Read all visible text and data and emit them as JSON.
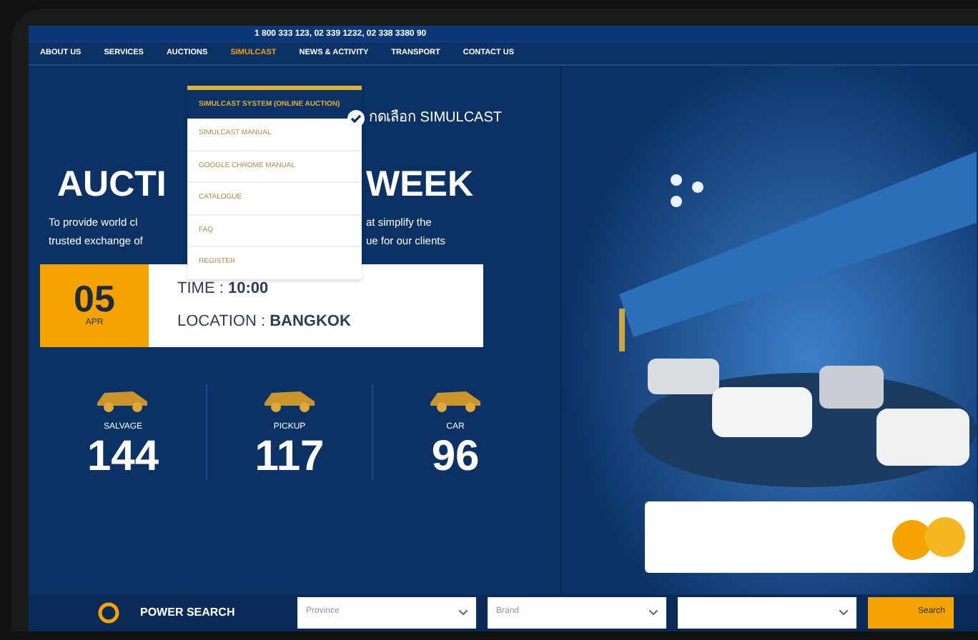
{
  "top_bar": {
    "phone": "1 800 333 123, 02 339 1232, 02 338 3380 90"
  },
  "nav": [
    {
      "label": "ABOUT US",
      "selected": false
    },
    {
      "label": "SERVICES",
      "selected": false
    },
    {
      "label": "AUCTIONS",
      "selected": false
    },
    {
      "label": "SIMULCAST",
      "selected": true
    },
    {
      "label": "NEWS & ACTIVITY",
      "selected": false
    },
    {
      "label": "TRANSPORT",
      "selected": false
    },
    {
      "label": "CONTACT US",
      "selected": false
    }
  ],
  "dropdown": [
    {
      "label": "SIMULCAST SYSTEM (ONLINE AUCTION)",
      "selected": true
    },
    {
      "label": "SIMULCAST MANUAL",
      "selected": false
    },
    {
      "label": "GOOGLE CHROME MANUAL",
      "selected": false
    },
    {
      "label": "CATALOGUE",
      "selected": false
    },
    {
      "label": "FAQ",
      "selected": false
    },
    {
      "label": "REGISTER",
      "selected": false
    }
  ],
  "callout": "กดเลือก SIMULCAST",
  "hero": {
    "title_left": "AUCTI",
    "title_right": "WEEK",
    "text_left": [
      "To provide world cl",
      "trusted exchange of"
    ],
    "text_right": [
      "at simplify the",
      "ue for our clients"
    ]
  },
  "date_card": {
    "day": "05",
    "month": "APR",
    "time_label": "TIME : ",
    "time": "10:00",
    "location_label": "LOCATION : ",
    "location": "BANGKOK"
  },
  "stats": [
    {
      "label": "SALVAGE",
      "count": "144"
    },
    {
      "label": "PICKUP",
      "count": "117"
    },
    {
      "label": "CAR",
      "count": "96"
    }
  ],
  "search_bar": {
    "title": "POWER SEARCH",
    "selects": [
      "Province",
      "Brand"
    ],
    "button": "Search"
  }
}
